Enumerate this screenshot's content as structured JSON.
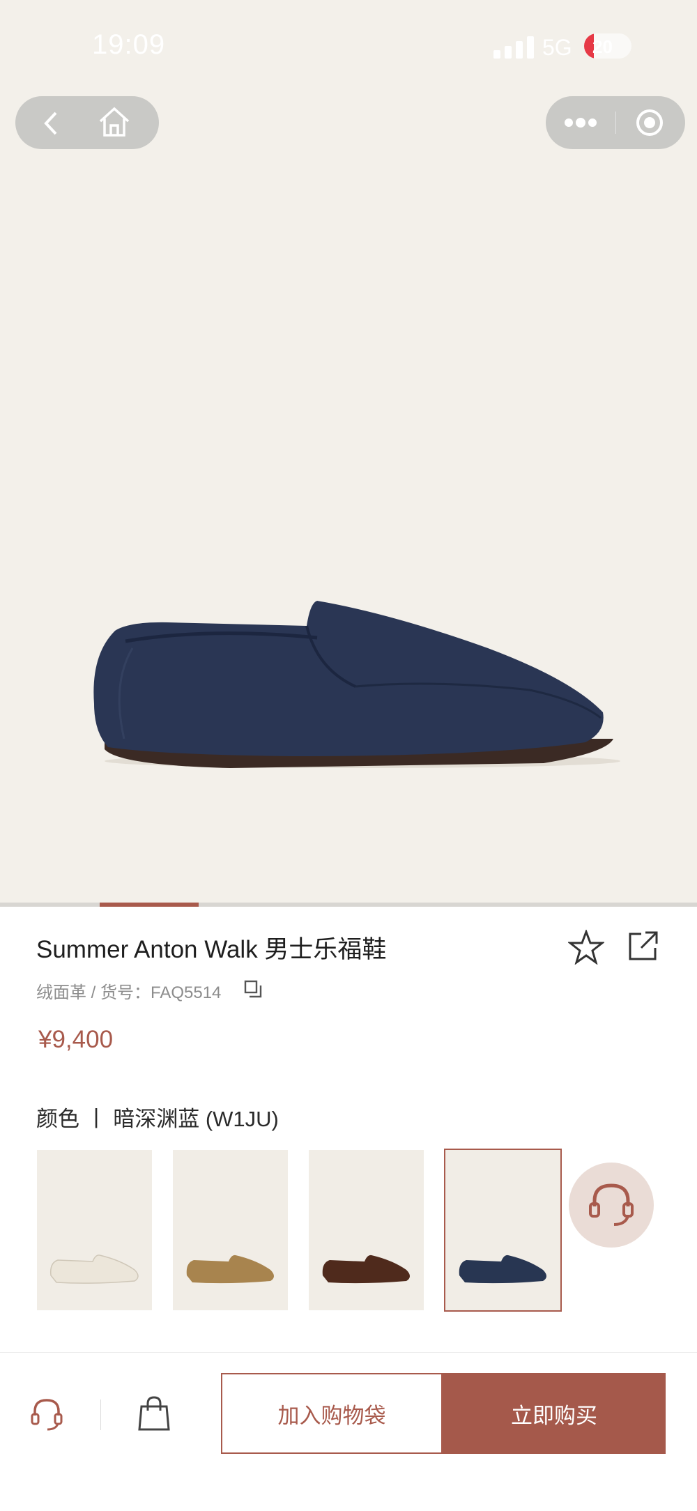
{
  "status": {
    "time": "19:09",
    "network": "5G",
    "battery": "20"
  },
  "product": {
    "name": "Summer Anton Walk 男士乐福鞋",
    "meta": "绒面革 / 货号：FAQ5514",
    "price": "¥9,400",
    "color_label": "颜色 丨 暗深渊蓝 (W1JU)",
    "gallery_progress": 0.143
  },
  "swatches": [
    {
      "color": "#ece6da",
      "selected": false
    },
    {
      "color": "#a8844e",
      "selected": false
    },
    {
      "color": "#4f2a1c",
      "selected": false
    },
    {
      "color": "#283652",
      "selected": true
    }
  ],
  "actions": {
    "add_to_bag": "加入购物袋",
    "buy_now": "立即购买"
  },
  "colors": {
    "accent": "#a85a4c",
    "hero_bg": "#f3f0ea",
    "shoe": "#2a3654"
  },
  "icons": [
    "back-icon",
    "home-icon",
    "more-icon",
    "target-icon",
    "star-icon",
    "share-icon",
    "copy-icon",
    "customer-service-icon",
    "shopping-bag-icon"
  ]
}
